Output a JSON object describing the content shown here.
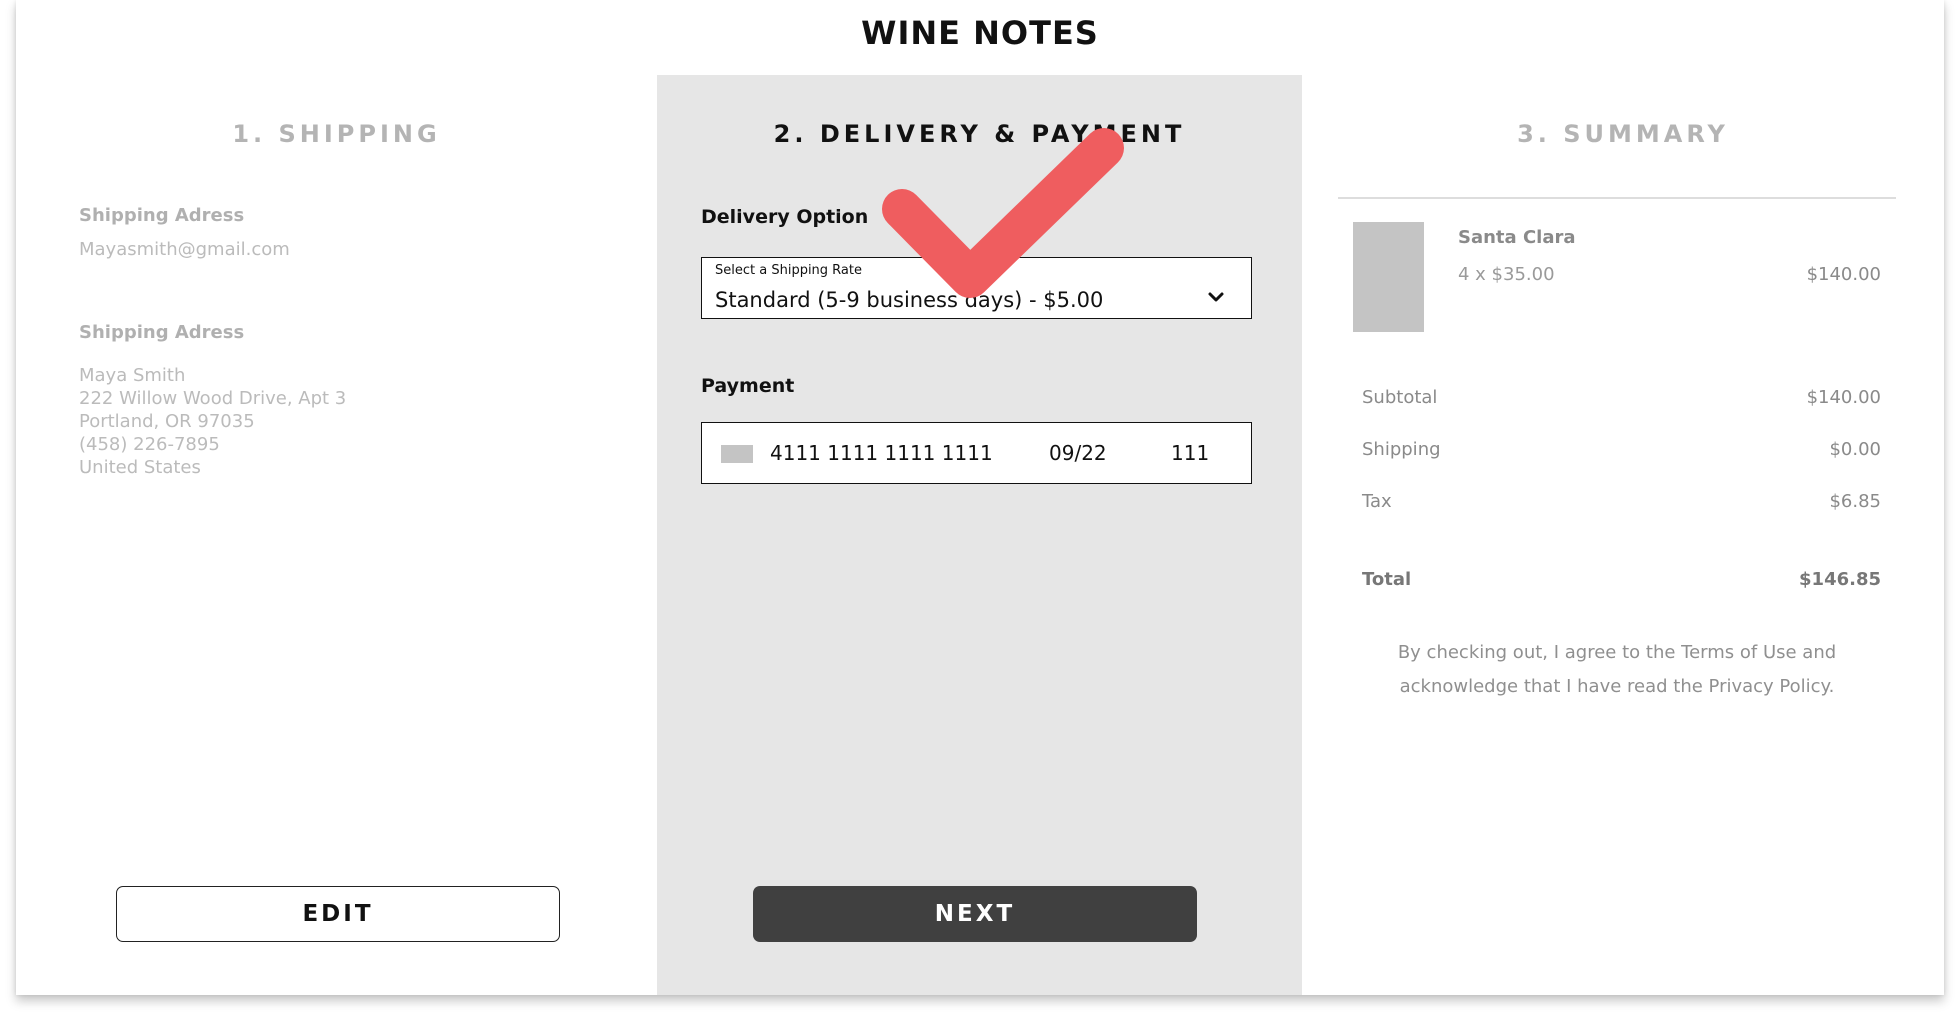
{
  "brand": "WINE NOTES",
  "steps": {
    "shipping": "1. SHIPPING",
    "delivery": "2. DELIVERY & PAYMENT",
    "summary": "3. SUMMARY"
  },
  "shipping": {
    "email_label": "Shipping Adress",
    "email": "Mayasmith@gmail.com",
    "address_label": "Shipping Adress",
    "address_lines": [
      "Maya Smith",
      "222 Willow Wood Drive, Apt 3",
      "Portland, OR 97035",
      "(458) 226-7895",
      "United States"
    ],
    "edit_button": "EDIT"
  },
  "delivery": {
    "option_label": "Delivery Option",
    "select_caption": "Select a Shipping Rate",
    "selected_rate": "Standard (5-9 business days) - $5.00",
    "payment_label": "Payment",
    "card_number": "4111 1111 1111 1111",
    "card_expiry": "09/22",
    "card_cvv": "111",
    "next_button": "NEXT"
  },
  "summary": {
    "product_name": "Santa Clara",
    "product_qty_price": "4 x $35.00",
    "product_total": "$140.00",
    "lines": [
      {
        "label": "Subtotal",
        "value": "$140.00"
      },
      {
        "label": "Shipping",
        "value": "$0.00"
      },
      {
        "label": "Tax",
        "value": "$6.85"
      }
    ],
    "total_label": "Total",
    "total_value": "$146.85",
    "terms": "By checking out, I agree to the Terms of Use and acknowledge that I have read the Privacy Policy."
  },
  "colors": {
    "checkmark": "#ef5d5f",
    "next_button": "#404040",
    "middle_panel": "#e6e6e6"
  },
  "icons": {
    "select_chevron": "chevron-down-icon",
    "card": "card-icon",
    "overlay": "checkmark-icon"
  }
}
